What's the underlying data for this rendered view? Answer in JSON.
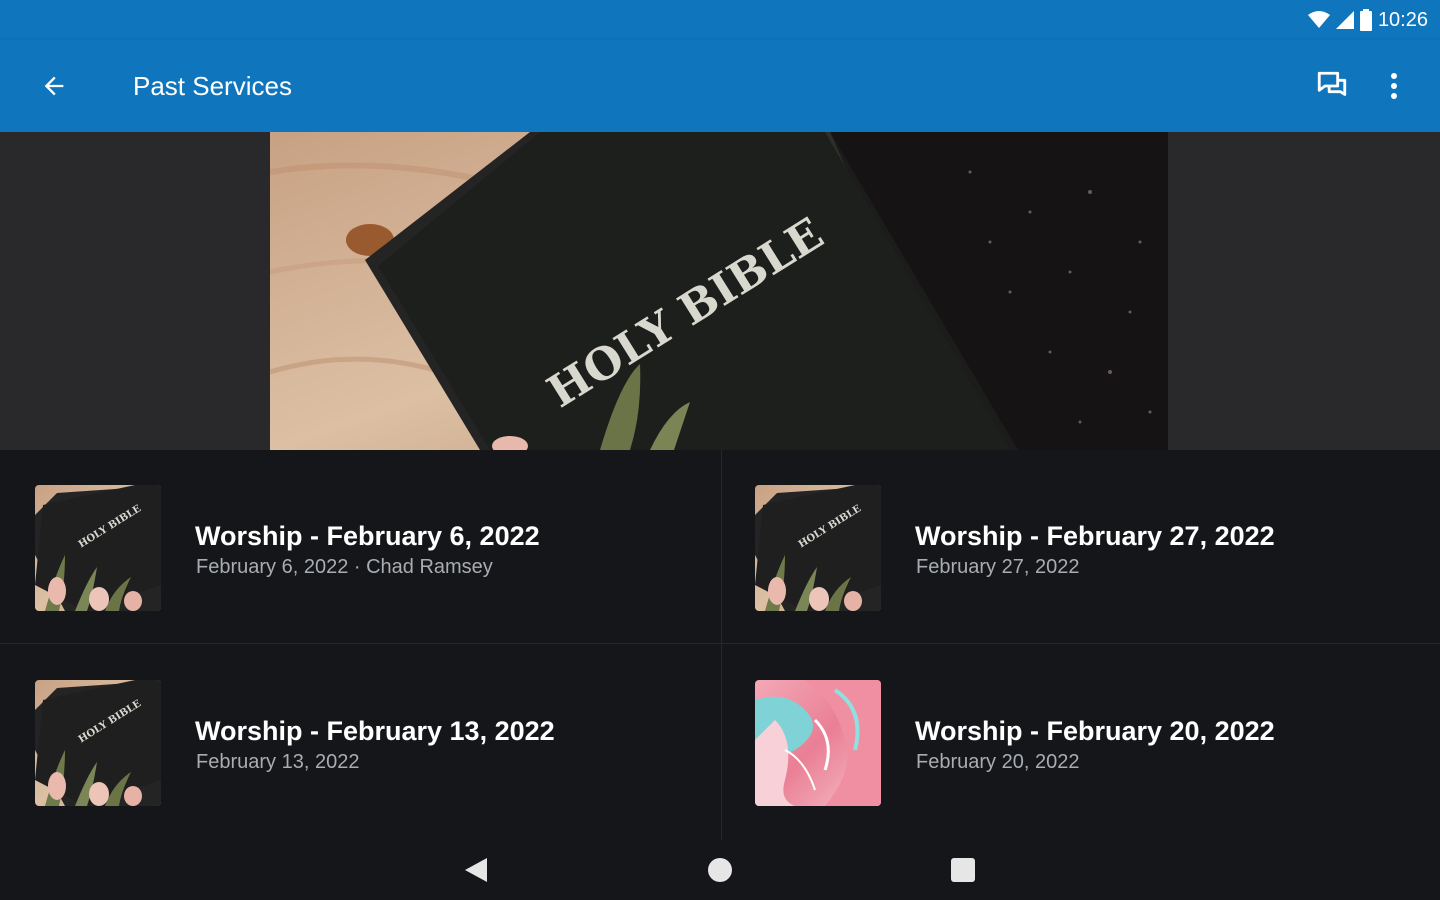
{
  "status_bar": {
    "time": "10:26",
    "icons": [
      "wifi-icon",
      "cell-signal-icon",
      "battery-icon"
    ]
  },
  "app_bar": {
    "title": "Past Services",
    "icons": [
      "arrow-back-icon",
      "chat-icon",
      "more-vert-icon"
    ]
  },
  "colors": {
    "app_bar": "#0f76bd",
    "background": "#141619",
    "hero_background": "#29292b",
    "subtitle": "#a9acb0"
  },
  "hero": {
    "cover_text": "HOLY BIBLE"
  },
  "services": [
    {
      "title": "Worship - February 6, 2022",
      "subtitle": "February 6, 2022 · Chad Ramsey",
      "thumbnail": "bible-thumbnail"
    },
    {
      "title": "Worship - February 27, 2022",
      "subtitle": "February 27, 2022",
      "thumbnail": "bible-thumbnail"
    },
    {
      "title": "Worship - February 13, 2022",
      "subtitle": "February 13, 2022",
      "thumbnail": "bible-thumbnail"
    },
    {
      "title": "Worship - February 20, 2022",
      "subtitle": "February 20, 2022",
      "thumbnail": "pink-abstract-thumbnail"
    }
  ],
  "nav_bar": {
    "icons": [
      "nav-back-icon",
      "nav-home-icon",
      "nav-recents-icon"
    ]
  }
}
